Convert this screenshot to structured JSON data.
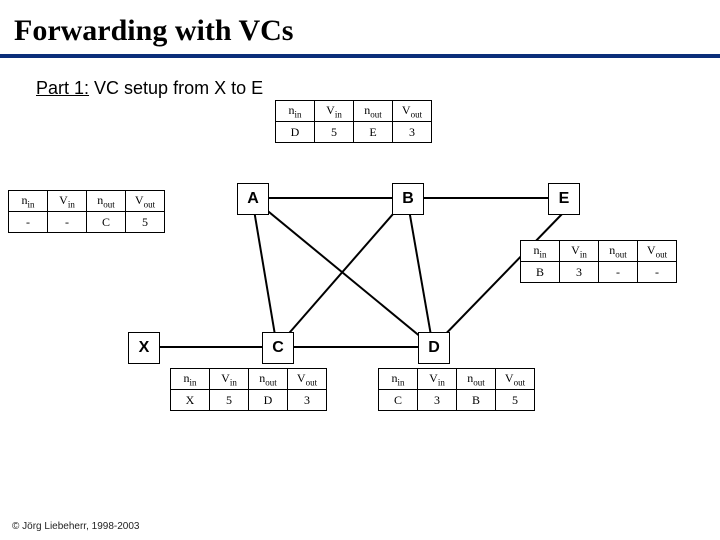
{
  "title": "Forwarding with VCs",
  "subtitle_part_label": "Part 1:",
  "subtitle_rest": " VC setup from X to E",
  "footer": "© Jörg Liebeherr, 1998-2003",
  "headers": {
    "nin": "n",
    "nin_sub": "in",
    "vin": "V",
    "vin_sub": "in",
    "nout": "n",
    "nout_sub": "out",
    "vout": "V",
    "vout_sub": "out"
  },
  "table_A": {
    "nin": "-",
    "vin": "-",
    "nout": "C",
    "vout": "5"
  },
  "table_Atop": {
    "nin": "D",
    "vin": "5",
    "nout": "E",
    "vout": "3"
  },
  "table_C": {
    "nin": "X",
    "vin": "5",
    "nout": "D",
    "vout": "3"
  },
  "table_D": {
    "nin": "C",
    "vin": "3",
    "nout": "B",
    "vout": "5"
  },
  "table_E": {
    "nin": "B",
    "vin": "3",
    "nout": "-",
    "vout": "-"
  },
  "nodes": {
    "A": "A",
    "B": "B",
    "C": "C",
    "D": "D",
    "E": "E",
    "X": "X"
  }
}
